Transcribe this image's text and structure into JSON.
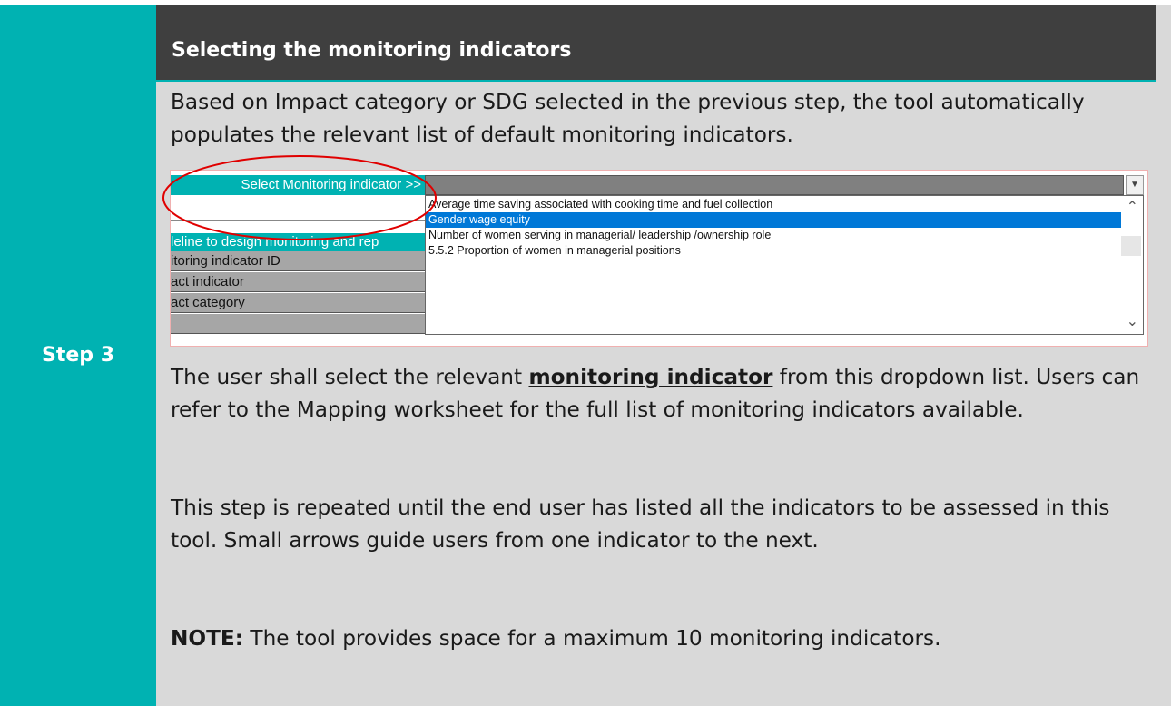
{
  "step": {
    "label": "Step 3"
  },
  "title": "Selecting the monitoring indicators",
  "intro": "Based on Impact category or SDG selected in the previous step, the tool automatically populates the relevant list of default monitoring indicators.",
  "screenshot": {
    "select_label": "Select Monitoring indicator >>",
    "side_rows": [
      {
        "text": "leline to design monitoring and rep",
        "style": "teal"
      },
      {
        "text": "itoring indicator ID",
        "style": "grey"
      },
      {
        "text": "act indicator",
        "style": "grey"
      },
      {
        "text": "act category",
        "style": "grey"
      },
      {
        "text": "",
        "style": "grey"
      }
    ],
    "dropdown_value": "",
    "options": [
      {
        "text": "Average time saving associated with cooking time and fuel collection",
        "selected": false
      },
      {
        "text": "Gender wage equity",
        "selected": true
      },
      {
        "text": "Number of women serving in managerial/ leadership /ownership role",
        "selected": false
      },
      {
        "text": "5.5.2 Proportion of women in managerial positions",
        "selected": false
      }
    ],
    "highlight_color": "#0078d7",
    "annotation_color": "#e00000"
  },
  "para1": {
    "before": "The user shall select the relevant ",
    "emphasis": "monitoring indicator",
    "after": " from this dropdown list. Users can refer to the Mapping worksheet for the full list of monitoring indicators available."
  },
  "para2": "This step is repeated until the end user has listed all the indicators to be assessed in this tool. Small arrows guide users from one indicator to the next.",
  "note": {
    "label": "NOTE:",
    "text": " The tool provides space for a maximum 10 monitoring indicators."
  },
  "colors": {
    "teal": "#00b2b2",
    "dark_header": "#3f3f3f",
    "panel": "#d9d9d9"
  }
}
